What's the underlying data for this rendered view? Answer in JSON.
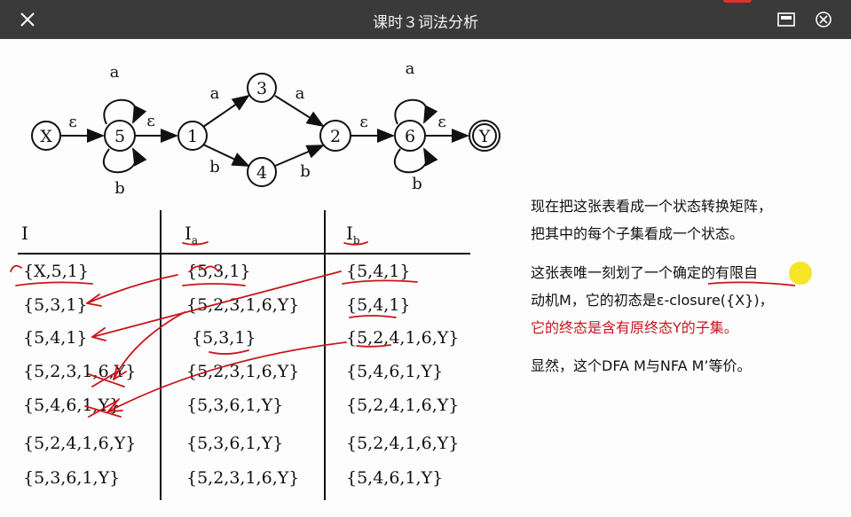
{
  "topbar": {
    "title": "课时３词法分析",
    "icons": [
      "close-icon",
      "window-icon",
      "fullscreen-icon"
    ]
  },
  "graph": {
    "nodes": [
      "X",
      "5",
      "1",
      "3",
      "4",
      "2",
      "6",
      "Y"
    ],
    "edge_labels": {
      "x5": "ε",
      "loop5a": "a",
      "loop5b": "b",
      "e51": "ε",
      "a13": "a",
      "b14": "b",
      "a32": "a",
      "b42": "b",
      "e26": "ε",
      "loop6a": "a",
      "loop6b": "b",
      "e6y": "ε"
    }
  },
  "table": {
    "headers": [
      {
        "main": "I",
        "sub": ""
      },
      {
        "main": "I",
        "sub": "a"
      },
      {
        "main": "I",
        "sub": "b"
      }
    ],
    "rows": [
      [
        "{X,5,1}",
        "{5,3,1}",
        "{5,4,1}"
      ],
      [
        "{5,3,1}",
        "{5,2,3,1,6,Y}",
        "{5,4,1}"
      ],
      [
        "{5,4,1}",
        "{5,3,1}",
        "{5,2,4,1,6,Y}"
      ],
      [
        "{5,2,3,1,6,Y}",
        "{5,2,3,1,6,Y}",
        "{5,4,6,1,Y}"
      ],
      [
        "{5,4,6,1,Y}",
        "{5,3,6,1,Y}",
        "{5,2,4,1,6,Y}"
      ],
      [
        "{5,2,4,1,6,Y}",
        "{5,3,6,1,Y}",
        "{5,2,4,1,6,Y}"
      ],
      [
        "{5,3,6,1,Y}",
        "{5,2,3,1,6,Y}",
        "{5,4,6,1,Y}"
      ]
    ]
  },
  "notes": {
    "p1_line1": "现在把这张表看成一个状态转换矩阵，",
    "p1_line2": "把其中的每个子集看成一个状态。",
    "p2_line1": "这张表唯一刻划了一个确定的有限自",
    "p2_line2": "动机M，它的初态是ε-closure({X})，",
    "p2_line3_red": "它的终态是含有原终态Y的子集。",
    "p3": "显然，这个DFA M与NFA M’等价。"
  },
  "colors": {
    "topbar": "#3a3a3a",
    "annotation_red": "#c8161d",
    "highlight": "#f5e000"
  }
}
